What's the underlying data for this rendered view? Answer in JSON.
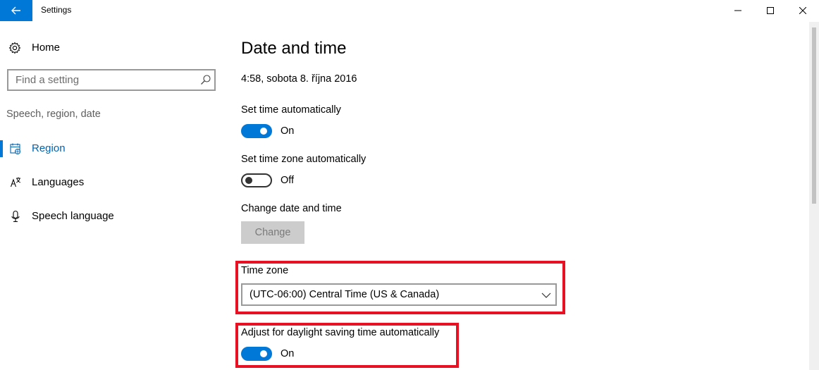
{
  "window": {
    "title": "Settings",
    "back_icon": "arrow-left-icon",
    "minimize_icon": "minimize-icon",
    "maximize_icon": "maximize-icon",
    "close_icon": "close-icon",
    "accent_color": "#0078d7"
  },
  "sidebar": {
    "home_label": "Home",
    "home_icon": "gear-icon",
    "search_placeholder": "Find a setting",
    "search_icon": "search-icon",
    "section_label": "Speech, region, date",
    "items": [
      {
        "label": "Region",
        "icon": "region-calendar-icon",
        "active": true
      },
      {
        "label": "Languages",
        "icon": "languages-icon",
        "active": false
      },
      {
        "label": "Speech language",
        "icon": "microphone-icon",
        "active": false
      }
    ]
  },
  "main": {
    "title": "Date and time",
    "current_time": "4:58, sobota 8. října 2016",
    "set_time_auto": {
      "label": "Set time automatically",
      "state": "On"
    },
    "set_timezone_auto": {
      "label": "Set time zone automatically",
      "state": "Off"
    },
    "change_date": {
      "label": "Change date and time",
      "button_label": "Change"
    },
    "time_zone": {
      "label": "Time zone",
      "value": "(UTC-06:00) Central Time (US & Canada)"
    },
    "daylight": {
      "label": "Adjust for daylight saving time automatically",
      "state": "On"
    },
    "highlight_color": "#e81123"
  }
}
